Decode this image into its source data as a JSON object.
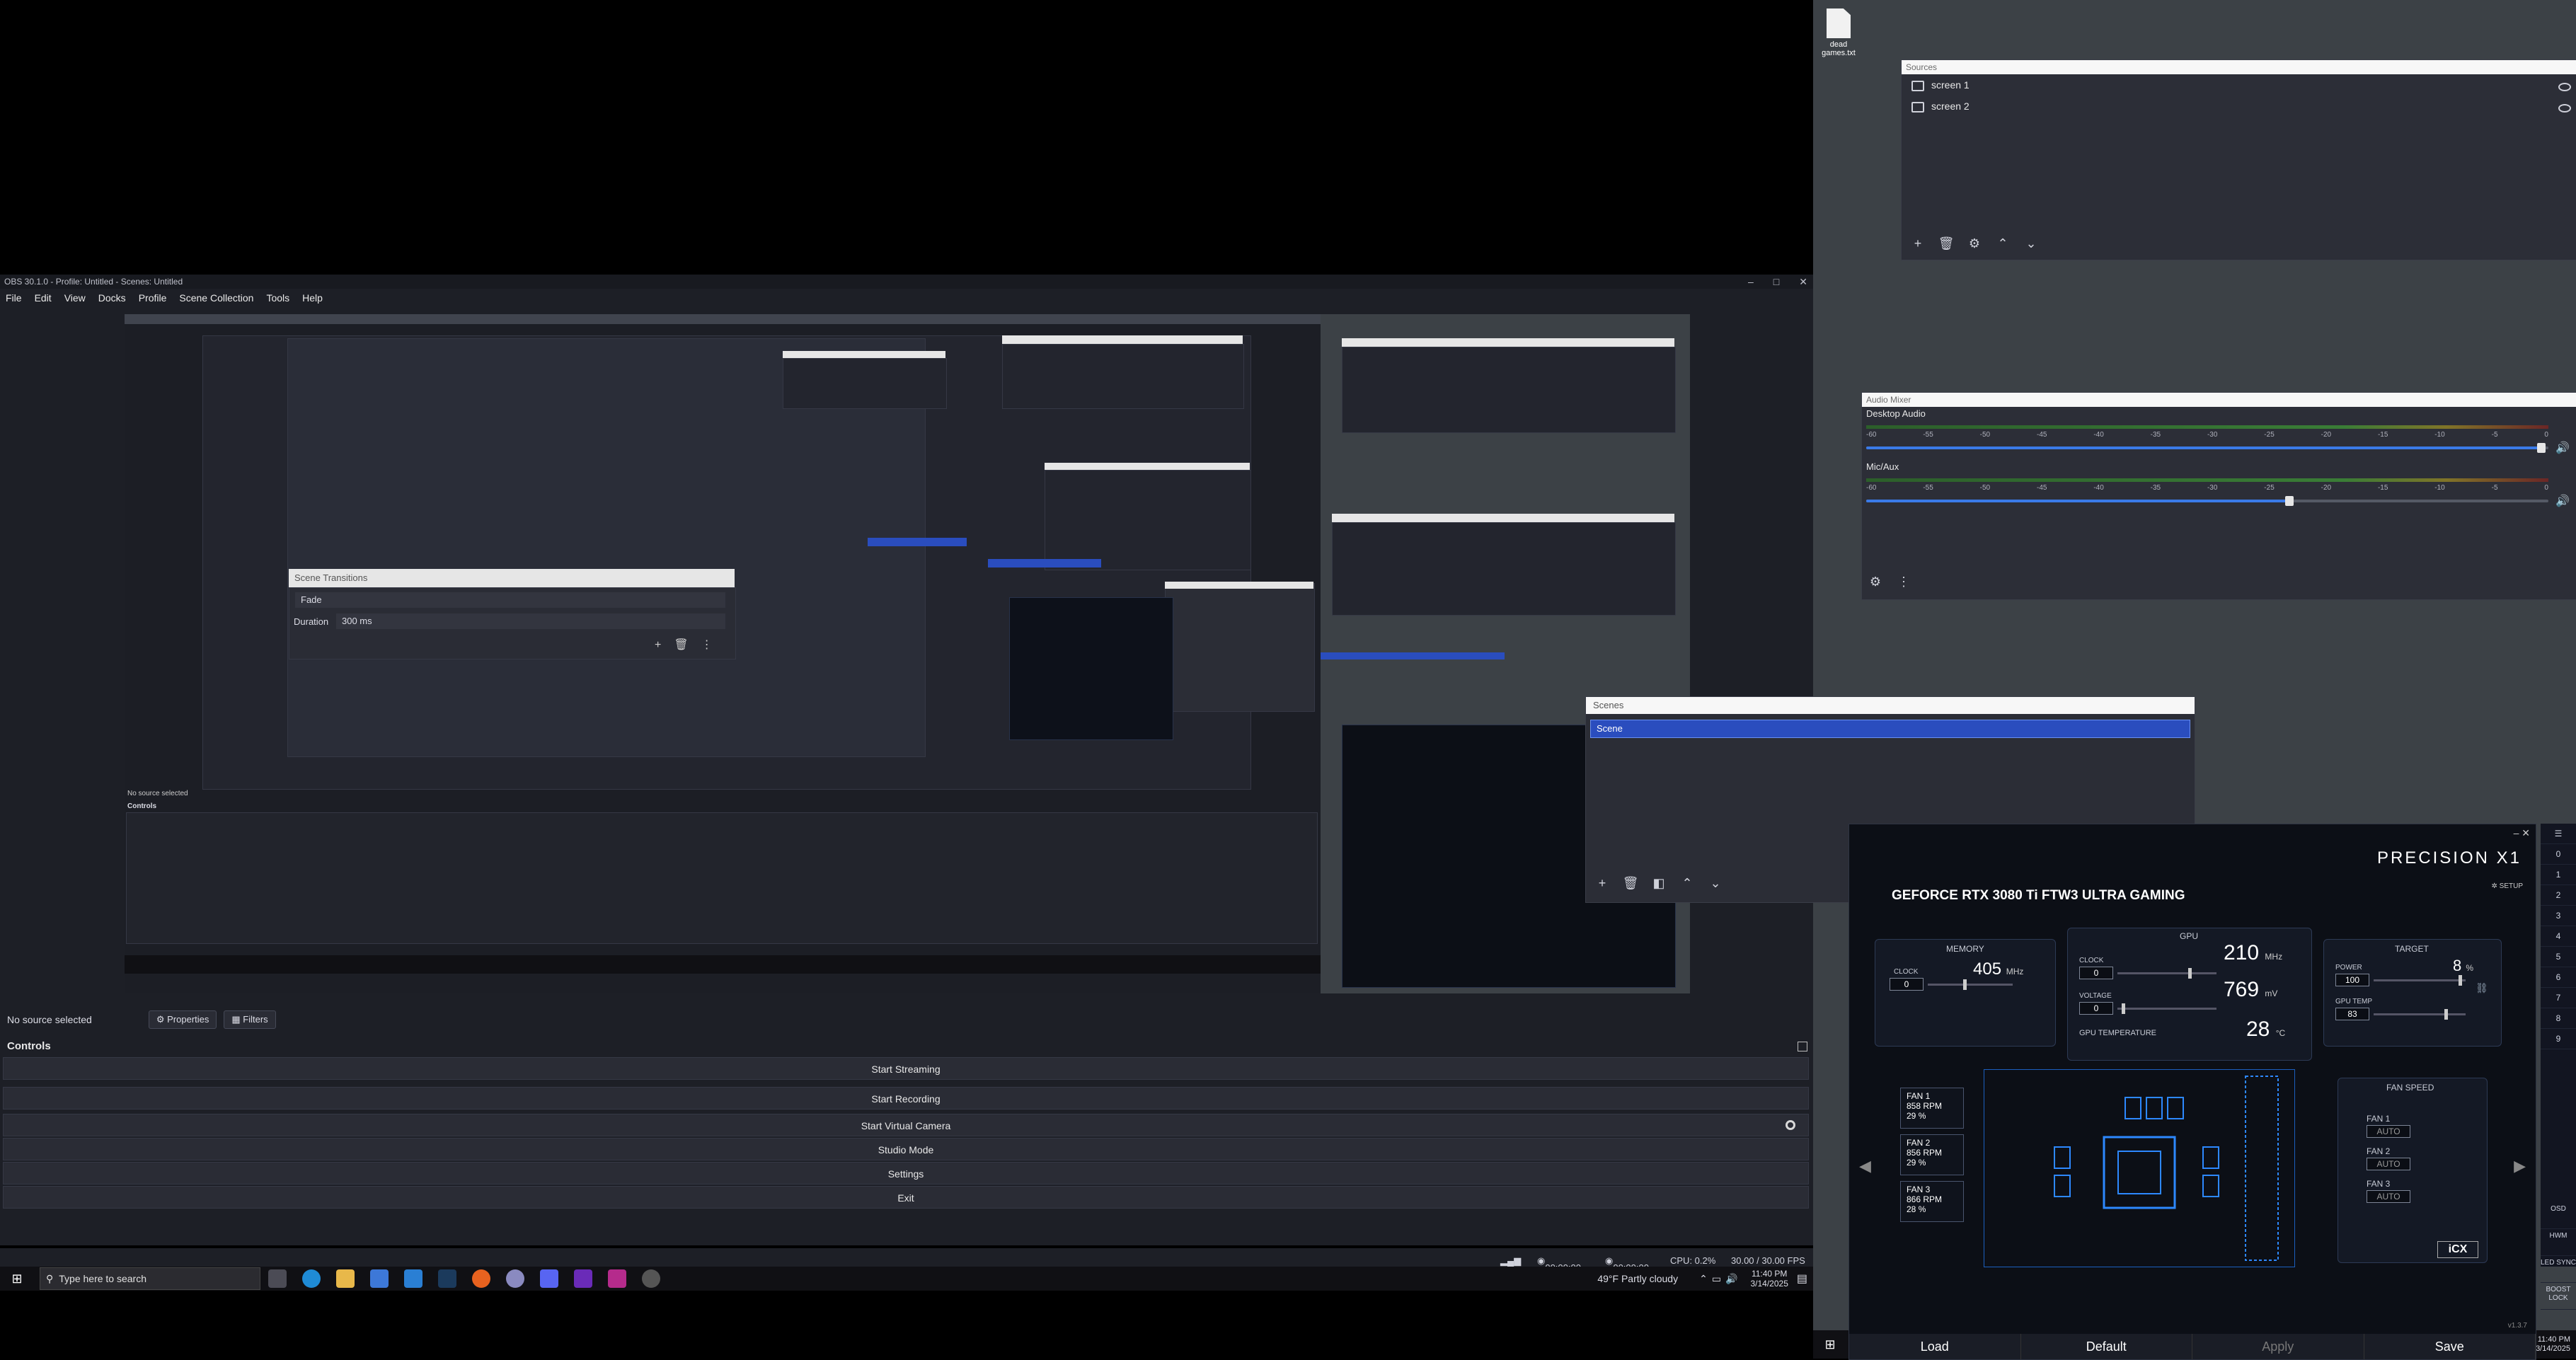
{
  "desktop": {
    "file_name": "dead games.txt",
    "clock": {
      "time": "11:40 PM",
      "date": "3/14/2025"
    }
  },
  "sources_dock": {
    "title": "Sources",
    "items": [
      {
        "label": "screen 1"
      },
      {
        "label": "screen 2"
      }
    ]
  },
  "audio_mixer": {
    "title": "Audio Mixer",
    "ticks": [
      "-60",
      "-55",
      "-50",
      "-45",
      "-40",
      "-35",
      "-30",
      "-25",
      "-20",
      "-15",
      "-10",
      "-5",
      "0"
    ],
    "channels": [
      {
        "name": "Desktop Audio",
        "volume_fraction": 0.99,
        "level": "0"
      },
      {
        "name": "Mic/Aux",
        "volume_fraction": 0.62,
        "level": "-12"
      }
    ]
  },
  "obs": {
    "title": "OBS 30.1.0 - Profile: Untitled - Scenes: Untitled",
    "menu": [
      "File",
      "Edit",
      "View",
      "Docks",
      "Profile",
      "Scene Collection",
      "Tools",
      "Help"
    ],
    "nested_scene_transitions": {
      "title": "Scene Transitions",
      "transition": "Fade",
      "duration_label": "Duration",
      "duration": "300 ms"
    },
    "no_source": "No source selected",
    "properties": "Properties",
    "filters": "Filters",
    "controls_title": "Controls",
    "controls": [
      "Start Streaming",
      "Start Recording",
      "Start Virtual Camera",
      "Studio Mode",
      "Settings",
      "Exit"
    ],
    "status": {
      "stream_time": "00:00:00",
      "rec_time": "00:00:00",
      "cpu": "CPU: 0.2%",
      "fps": "30.00 / 30.00 FPS"
    }
  },
  "scenes_dock": {
    "title": "Scenes",
    "items": [
      {
        "label": "Scene",
        "selected": true
      }
    ]
  },
  "taskbar": {
    "search_placeholder": "Type here to search",
    "weather": "49°F  Partly cloudy",
    "time": "11:40 PM",
    "date": "3/14/2025"
  },
  "precision_x1": {
    "brand": "PRECISION X1",
    "setup": "SETUP",
    "card_name": "GEFORCE RTX 3080 Ti FTW3 ULTRA GAMING",
    "memory": {
      "title": "MEMORY",
      "clock_label": "CLOCK",
      "clock_offset": "0",
      "clock": "405",
      "unit": "MHz"
    },
    "gpu": {
      "title": "GPU",
      "clock_label": "CLOCK",
      "clock_offset": "0",
      "clock": "210",
      "clock_unit": "MHz",
      "voltage_label": "VOLTAGE",
      "voltage_offset": "0",
      "voltage": "769",
      "voltage_unit": "mV",
      "temp_label": "GPU TEMPERATURE",
      "temp": "28",
      "temp_unit": "°C"
    },
    "target": {
      "title": "TARGET",
      "power_label": "POWER",
      "power": "100",
      "power_pct": "8",
      "power_unit": "%",
      "temp_label": "GPU TEMP",
      "temp": "83"
    },
    "fans": [
      {
        "label": "FAN 1",
        "rpm": "858",
        "rpm_unit": "RPM",
        "pct": "29",
        "pct_unit": "%"
      },
      {
        "label": "FAN 2",
        "rpm": "856",
        "rpm_unit": "RPM",
        "pct": "29",
        "pct_unit": "%"
      },
      {
        "label": "FAN 3",
        "rpm": "866",
        "rpm_unit": "RPM",
        "pct": "28",
        "pct_unit": "%"
      }
    ],
    "fan_speed": {
      "title": "FAN SPEED",
      "fans": [
        {
          "label": "FAN 1",
          "mode": "AUTO"
        },
        {
          "label": "FAN 2",
          "mode": "AUTO"
        },
        {
          "label": "FAN 3",
          "mode": "AUTO"
        }
      ]
    },
    "icx": "iCX",
    "version": "v1.3.7",
    "footer": {
      "load": "Load",
      "default": "Default",
      "apply": "Apply",
      "save": "Save"
    },
    "profiles": [
      "0",
      "1",
      "2",
      "3",
      "4",
      "5",
      "6",
      "7",
      "8",
      "9"
    ],
    "side_buttons": [
      "OSD",
      "HWM",
      "LED SYNC",
      "BOOST LOCK"
    ]
  }
}
